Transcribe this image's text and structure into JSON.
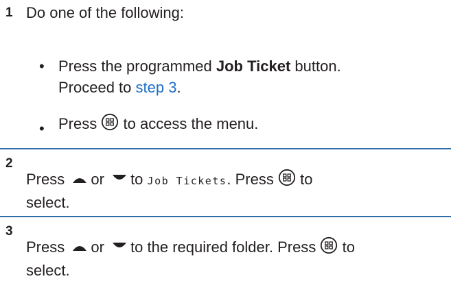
{
  "step1": {
    "number": "1",
    "intro": "Do one of the following:",
    "bullets": [
      {
        "marker": "•",
        "prefix": "Press the programmed ",
        "bold": "Job Ticket",
        "suffix": " button.",
        "line2_prefix": "Proceed to ",
        "link": "step 3",
        "line2_suffix": "."
      },
      {
        "marker": "•",
        "prefix": "Press",
        "icon": "menu-ok-button-icon",
        "suffix": "to access the menu."
      }
    ]
  },
  "step2": {
    "number": "2",
    "press": "Press",
    "up_icon": "up-arrow-icon",
    "or": "or",
    "down_icon": "down-arrow-icon",
    "to": "to",
    "display_text": "Job Tickets",
    "period_press": ". Press",
    "ok_icon": "menu-ok-button-icon",
    "to2": "to",
    "line2": "select."
  },
  "step3": {
    "number": "3",
    "press": "Press",
    "up_icon": "up-arrow-icon",
    "or": "or",
    "down_icon": "down-arrow-icon",
    "text": "to the required folder. Press",
    "ok_icon": "menu-ok-button-icon",
    "to2": "to",
    "line2": "select."
  },
  "colors": {
    "text": "#231f20",
    "rule": "#2f6ea7",
    "link": "#1d6fc9"
  }
}
